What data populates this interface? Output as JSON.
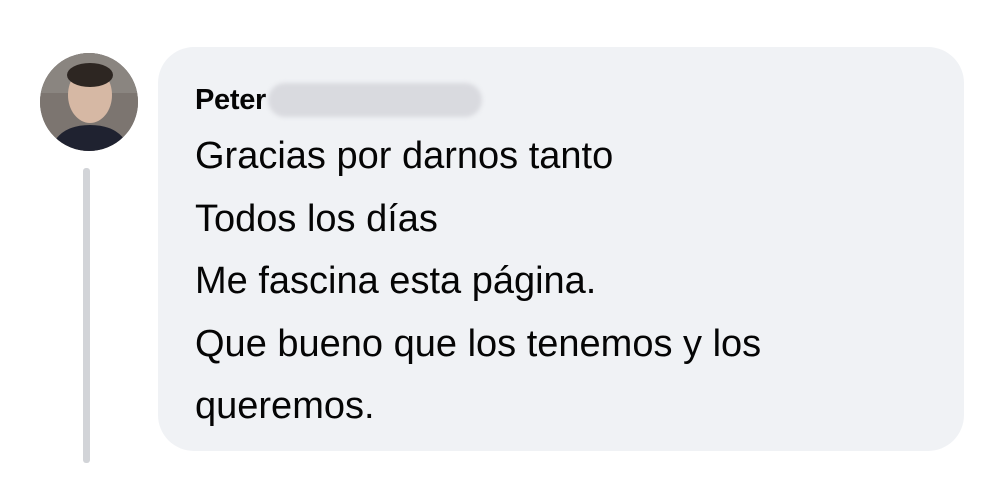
{
  "comment": {
    "author": {
      "name_visible": "Peter",
      "avatar_icon": "user-avatar-photo"
    },
    "lines": [
      "Gracias por darnos tanto",
      "Todos los días",
      "Me fascina esta página.",
      "Que bueno que los tenemos y los",
      "queremos."
    ]
  },
  "colors": {
    "bubble_bg": "#f0f2f5",
    "thread_line": "#d2d4d8",
    "text": "#050505"
  }
}
